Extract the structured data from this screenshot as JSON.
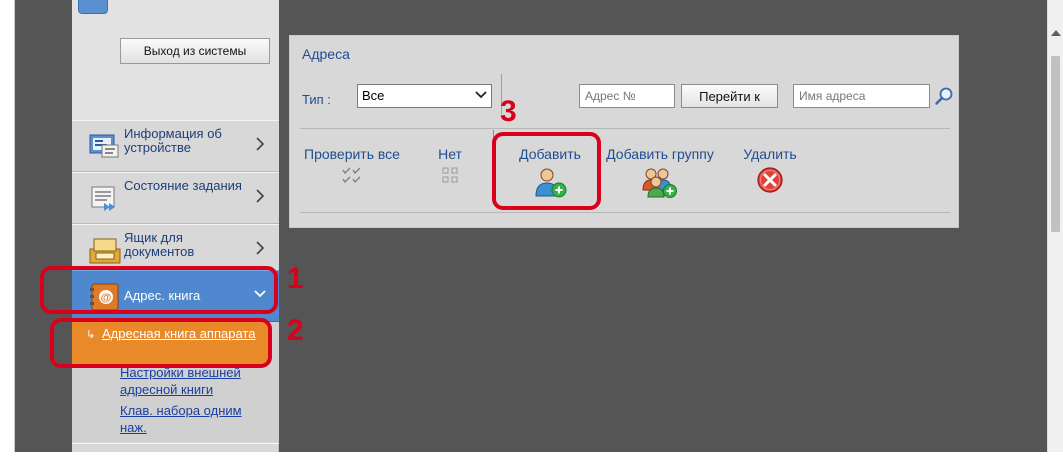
{
  "sidebar": {
    "logout_label": "Выход из системы",
    "items": [
      {
        "label": "Информация об устройстве",
        "icon": "device-info-icon"
      },
      {
        "label": "Состояние задания",
        "icon": "job-status-icon"
      },
      {
        "label": "Ящик для документов",
        "icon": "document-box-icon"
      },
      {
        "label": "Адрес. книга",
        "icon": "address-book-icon"
      }
    ],
    "submenu": {
      "active_label": "Адресная книга аппарата",
      "links": [
        "Настройки внешней адресной книги",
        "Клав. набора одним наж."
      ]
    }
  },
  "panel": {
    "title": "Адреса",
    "type_label": "Тип :",
    "type_value": "Все",
    "address_no_placeholder": "Адрес №",
    "goto_label": "Перейти к",
    "address_name_placeholder": "Имя адреса",
    "actions": {
      "check_all": "Проверить все",
      "none": "Нет",
      "add": "Добавить",
      "add_group": "Добавить группу",
      "delete": "Удалить"
    }
  },
  "annotations": {
    "one": "1",
    "two": "2",
    "three": "3"
  },
  "colors": {
    "accent_blue": "#4f88cf",
    "active_orange": "#e8892a",
    "annotation_red": "#d9001b",
    "link_blue": "#1f4d91"
  }
}
